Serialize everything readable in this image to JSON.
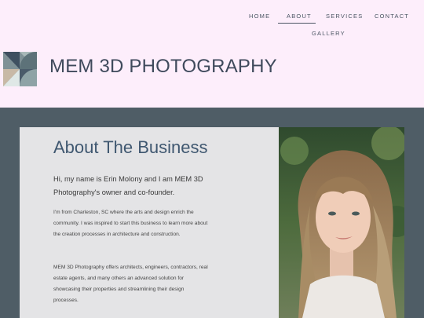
{
  "nav": {
    "home": "HOME",
    "about": "ABOUT",
    "services": "SERVICES",
    "contact": "CONTACT",
    "gallery": "GALLERY"
  },
  "brand": {
    "name": "MEM 3D PHOTOGRAPHY",
    "logo_icon": "geometric-logo-icon"
  },
  "about": {
    "title": "About The Business",
    "lead": "Hi, my name is Erin Molony and I am MEM 3D Photography's owner and co-founder.",
    "para1": "I'm from Charleston, SC where the arts and design enrich the community. I was inspired to start this business to learn more about the creation processes in architecture and construction.",
    "para2": "MEM 3D Photography offers architects, engineers, contractors, real estate agents, and many others an advanced solution for showcasing their properties and streamlining their design processes."
  },
  "colors": {
    "header_bg": "#fdeefb",
    "section_bg": "#4f5d66",
    "card_bg": "#e4e4e6",
    "title_color": "#3f5770"
  }
}
